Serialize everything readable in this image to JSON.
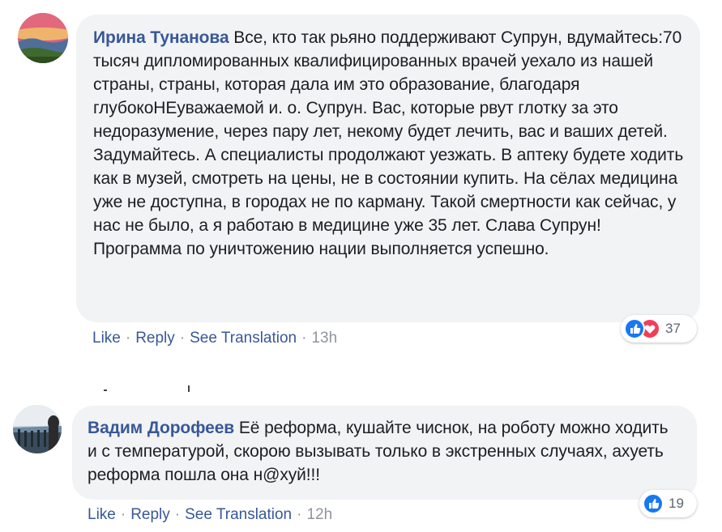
{
  "comments": [
    {
      "author": "Ирина Тунанова",
      "text": "Все, кто так рьяно поддерживают Супрун, вдумайтесь:70 тысяч дипломированных квалифицированных врачей уехало из нашей страны, страны, которая дала им это образование, благодаря глубокоНЕуважаемой и. о. Супрун. Вас, которые рвут глотку за это недоразумение, через пару лет, некому будет лечить, вас и ваших детей. Задумайтесь. А специалисты продолжают уезжать. В аптеку будете ходить как в музей, смотреть на цены, не в состоянии купить. На сёлах медицина уже не доступна, в городах не по карману. Такой смертности как сейчас, у нас не было, а я работаю в медицине уже 35 лет. Слава Супрун! Программа по уничтожению нации выполняется успешно.",
      "actions": {
        "like": "Like",
        "reply": "Reply",
        "translate": "See Translation",
        "time": "13h"
      },
      "reactions": {
        "count": "37",
        "icons": [
          "like-icon",
          "love-icon"
        ]
      }
    },
    {
      "author": "Вадим Дорофеев",
      "text": "Её реформа, кушайте чиснок, на роботу можно ходить и с температурой, скорою вызывать только в экстренных случаях, ахуеть реформа пошла она н@хуй!!!",
      "actions": {
        "like": "Like",
        "reply": "Reply",
        "translate": "See Translation",
        "time": "12h"
      },
      "reactions": {
        "count": "19",
        "icons": [
          "like-icon"
        ]
      }
    }
  ],
  "separator": "·",
  "colors": {
    "link": "#385898",
    "bubble": "#f2f3f5",
    "like": "#1877f2",
    "love": "#f33e58"
  }
}
